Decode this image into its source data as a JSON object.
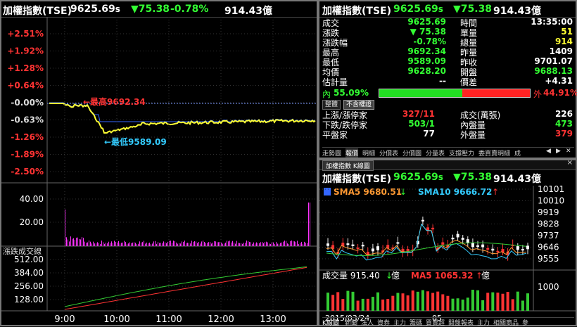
{
  "colors": {
    "up": "#ff3333",
    "down": "#33ff33",
    "price_line": "#ffff33",
    "avg_line": "#3366ff",
    "volume": "#ff33ff",
    "sma5": "#ff9933",
    "sma10": "#33ccff"
  },
  "left": {
    "title": "加權指數(TSE)",
    "price": "9625.69",
    "price_suffix": "s",
    "change": "▼75.38",
    "pct": "-0.78%",
    "amount": "914.43億",
    "yticks": [
      "+2.51%",
      "+1.92%",
      "+1.28%",
      "+0.64%",
      "-0.00%",
      "-0.63%",
      "-1.26%",
      "-1.89%",
      "-2.50%"
    ],
    "high_label": "←最高9692.34",
    "low_label": "←最低9589.09",
    "vol_ticks": [
      "40.00",
      "20.00"
    ],
    "breadth_title": "漲跌成交線",
    "breadth_ticks": [
      "512.00",
      "384.00",
      "256.00",
      "128.00"
    ],
    "xticks": [
      "9:00",
      "10:00",
      "11:00",
      "12:00",
      "13:00"
    ]
  },
  "right": {
    "title": "加權指數(TSE)",
    "price": "9625.69",
    "price_suffix": "s",
    "change": "▼75.38",
    "amount": "914.43億",
    "quote_left": [
      {
        "label": "成交",
        "value": "9625.69",
        "color": "#33ff33"
      },
      {
        "label": "漲跌",
        "value": "▼ 75.38",
        "color": "#33ff33"
      },
      {
        "label": "漲跌幅",
        "value": "-0.78%",
        "color": "#33ff33"
      },
      {
        "label": "最高",
        "value": "9692.34",
        "color": "#33ff33"
      },
      {
        "label": "最低",
        "value": "9589.09",
        "color": "#33ff33"
      },
      {
        "label": "均價",
        "value": "9628.20",
        "color": "#33ff33"
      },
      {
        "label": "估計量",
        "value": "--",
        "color": "#ffffff"
      }
    ],
    "quote_right": [
      {
        "label": "時間",
        "value": "13:35:00",
        "color": "#ffffff"
      },
      {
        "label": "單量",
        "value": "51",
        "color": "#ffff33"
      },
      {
        "label": "總量",
        "value": "914",
        "color": "#ffff33"
      },
      {
        "label": "昨量",
        "value": "1409",
        "color": "#ffffff"
      },
      {
        "label": "昨收",
        "value": "9701.07",
        "color": "#ffffff"
      },
      {
        "label": "開盤",
        "value": "9688.13",
        "color": "#33ff33"
      },
      {
        "label": "價差",
        "value": "+4.31",
        "color": "#ffffff"
      }
    ],
    "inner_label": "內",
    "inner_pct": "55.09%",
    "outer_label": "外",
    "outer_pct": "44.91%",
    "inner_ratio": 0.5509,
    "btn_summary": "整體",
    "btn_no_warrant": "不含權證",
    "breadth": [
      {
        "label": "上漲/漲停家",
        "value": "327/11",
        "color": "#ff3333"
      },
      {
        "label": "下跌/跌停家",
        "value": "503/1",
        "color": "#33ff33"
      },
      {
        "label": "平盤家",
        "value": "77",
        "color": "#ffffff"
      }
    ],
    "breadth_right": [
      {
        "label": "成交(萬張)",
        "value": "226",
        "color": "#ffffff"
      },
      {
        "label": "內盤量",
        "value": "473",
        "color": "#33ff33"
      },
      {
        "label": "外盤量",
        "value": "379",
        "color": "#ff3333"
      }
    ],
    "tabs": [
      "走勢圖",
      "報價",
      "明細",
      "分價表",
      "分價圖",
      "分量表",
      "支撐壓力",
      "委買賣明細",
      "成"
    ],
    "kchart_tab": "加權指數 K線圖",
    "k_title": "加權指數(TSE)",
    "k_price": "9625.69",
    "k_price_suffix": "s",
    "k_change": "▼75.38",
    "k_amount": "914.43億",
    "sma5": "SMA5 9680.51",
    "sma10": "SMA10 9666.72",
    "k_yticks": [
      "10101",
      "10010",
      "9919",
      "9828",
      "9737",
      "9646",
      "9555"
    ],
    "vol_label": "成交量 915.40",
    "vol_unit": "億",
    "ma5": "MA5 1065.32",
    "ma5_unit": "億",
    "vol_tick": "1000",
    "date_ticks": [
      "2015/03/24",
      "05"
    ],
    "bottom_tabs": [
      "K線圖",
      "新聞",
      "法人",
      "資券",
      "主力",
      "籌碼",
      "買賣超",
      "閱盤報表",
      "主力",
      "相關商品",
      "參"
    ]
  }
}
